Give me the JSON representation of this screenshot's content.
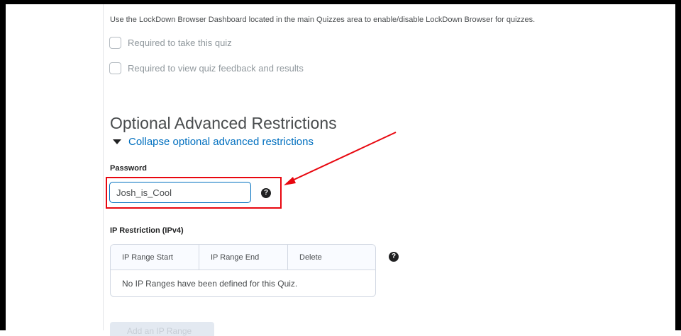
{
  "lockdown": {
    "info_text": "Use the LockDown Browser Dashboard located in the main Quizzes area to enable/disable LockDown Browser for quizzes.",
    "required_take_label": "Required to take this quiz",
    "required_view_label": "Required to view quiz feedback and results"
  },
  "advanced": {
    "title": "Optional Advanced Restrictions",
    "collapse_label": "Collapse optional advanced restrictions",
    "password_label": "Password",
    "password_value": "Josh_is_Cool",
    "help_glyph": "?"
  },
  "ip_restriction": {
    "label": "IP Restriction (IPv4)",
    "columns": [
      "IP Range Start",
      "IP Range End",
      "Delete"
    ],
    "empty_message": "No IP Ranges have been defined for this Quiz.",
    "add_button_label": "Add an IP Range"
  },
  "annotation": {
    "highlight_color": "#e8070f"
  }
}
